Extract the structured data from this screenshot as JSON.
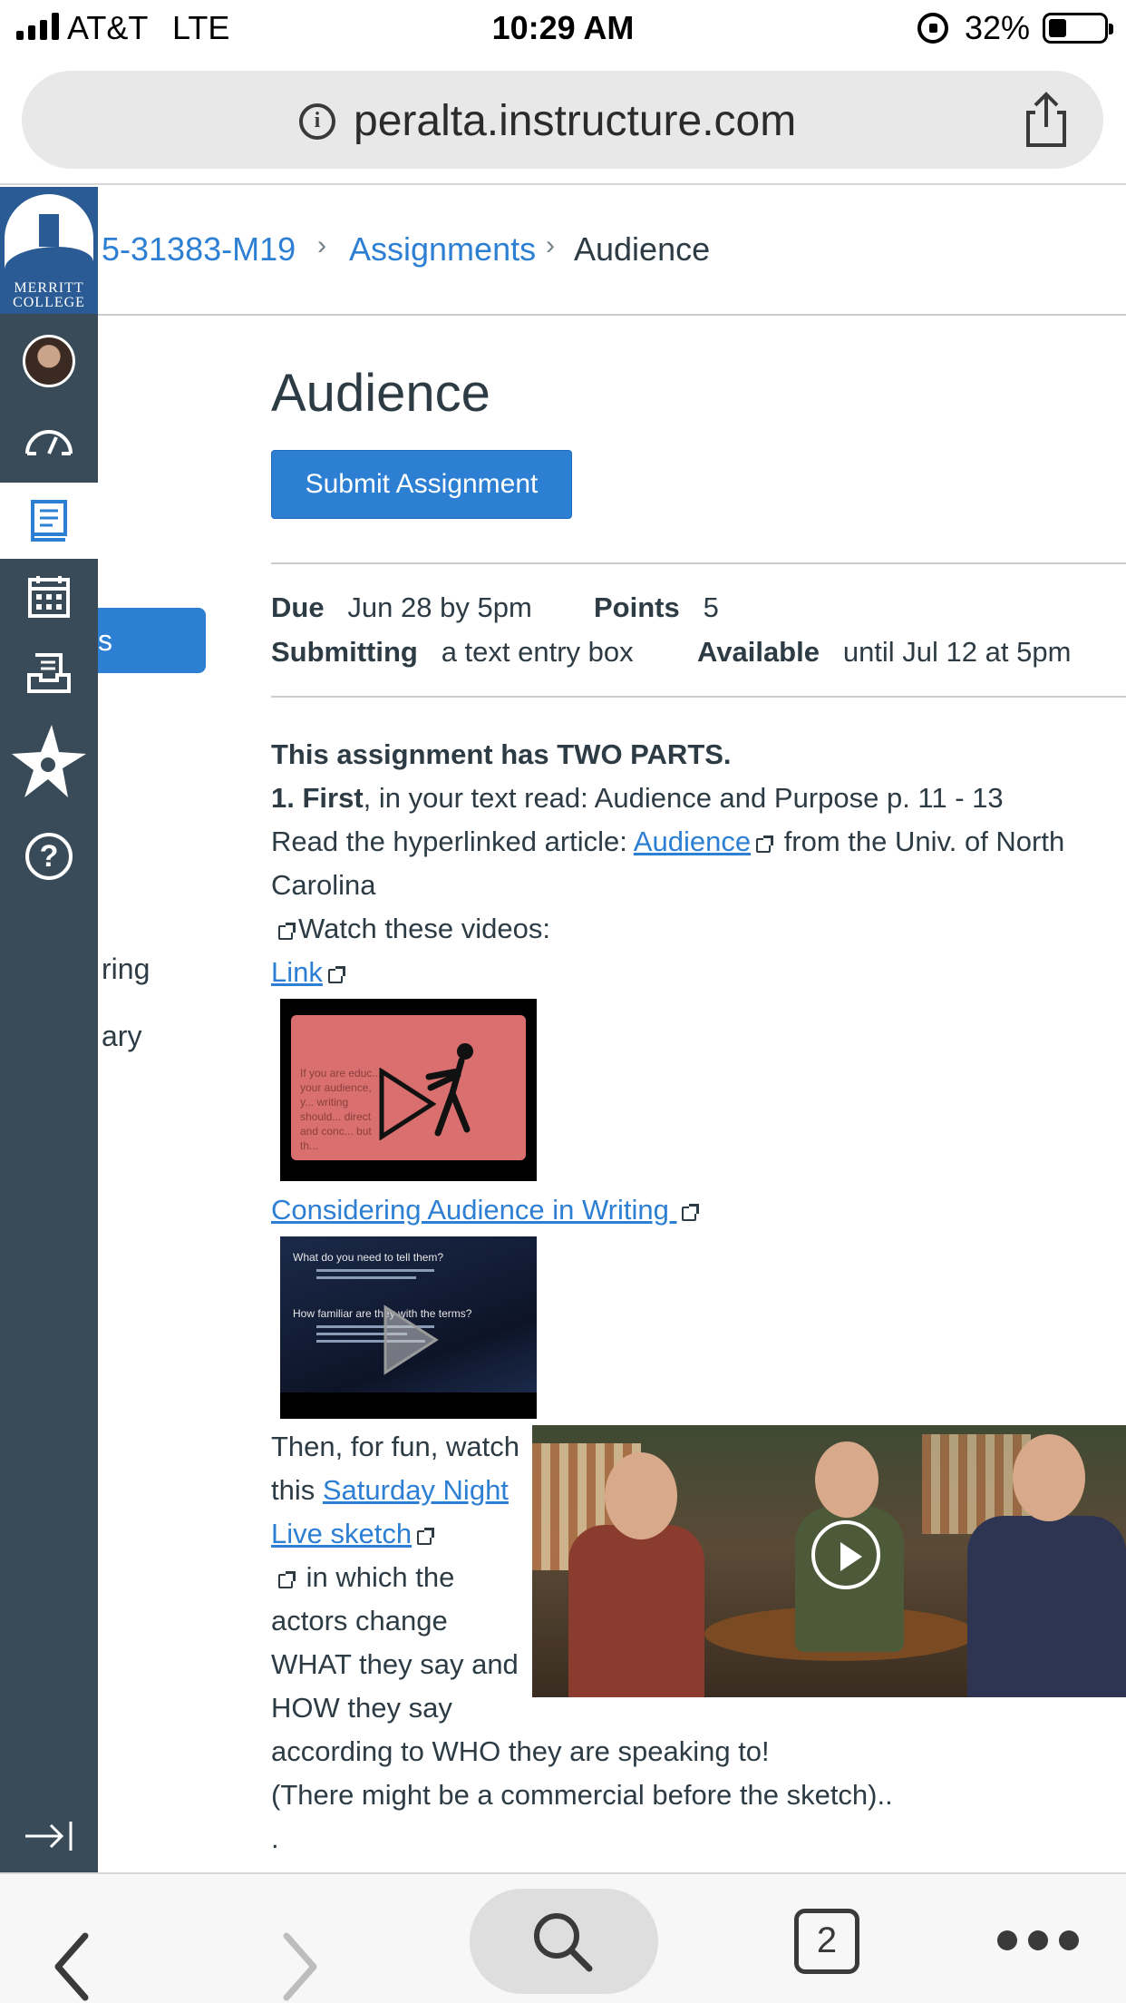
{
  "status_bar": {
    "carrier": "AT&T",
    "network": "LTE",
    "time": "10:29 AM",
    "battery_percent": "32%",
    "battery_level": 0.32
  },
  "browser": {
    "url": "peralta.instructure.com",
    "tab_count": "2"
  },
  "global_nav": {
    "logo_line1": "MERRITT",
    "logo_line2": "COLLEGE",
    "items": [
      {
        "name": "account",
        "icon": "avatar"
      },
      {
        "name": "dashboard",
        "icon": "dashboard-icon"
      },
      {
        "name": "courses",
        "icon": "courses-icon",
        "active": true
      },
      {
        "name": "calendar",
        "icon": "calendar-icon"
      },
      {
        "name": "inbox",
        "icon": "inbox-icon"
      },
      {
        "name": "commons",
        "icon": "star-icon"
      },
      {
        "name": "help",
        "icon": "help-icon",
        "glyph": "?"
      }
    ]
  },
  "breadcrumb": {
    "course": "5-31383-M19",
    "section": "Assignments",
    "current": "Audience",
    "separator": "›"
  },
  "course_nav": {
    "active_label_fragment": "s",
    "fragment_1": "ring",
    "fragment_2": "ary"
  },
  "assignment": {
    "title": "Audience",
    "submit_label": "Submit Assignment",
    "due_label": "Due",
    "due_value": "Jun 28 by 5pm",
    "points_label": "Points",
    "points_value": "5",
    "submitting_label": "Submitting",
    "submitting_value": "a text entry box",
    "available_label": "Available",
    "available_value": "until Jul 12 at 5pm"
  },
  "body": {
    "heading": "This assignment has TWO PARTS.",
    "first_bold": "1. First",
    "first_rest": ", in your text read: Audience and Purpose p. 11 - 13",
    "read_prefix": "Read the hyperlinked article: ",
    "read_link": "Audience",
    "read_suffix": " from the Univ. of North",
    "read_suffix2": "Carolina",
    "watch": "Watch these videos:",
    "link1": "Link",
    "video1_text": "If you are educ... your audience, y... writing should... direct and conc... but th...",
    "link2": "Considering Audience in Writing ",
    "video2_line1": "What do you need to tell them?",
    "video2_line2": "How familiar are they with the terms?",
    "then_1": "Then, for fun, watch",
    "then_2_prefix": "this ",
    "snl_link_1": "Saturday Night",
    "snl_link_2": "Live sketch",
    "then_3": " in which the",
    "then_4": "actors change",
    "then_5": "WHAT they say and",
    "then_6": "HOW they say",
    "then_7": "according to WHO they are speaking to!",
    "then_8": "(There might be a commercial before the sketch)..",
    "then_9": "."
  },
  "colors": {
    "link": "#2d7fd3",
    "nav_bg": "#394b58",
    "text": "#2d3b45",
    "button": "#2d7fd3"
  }
}
